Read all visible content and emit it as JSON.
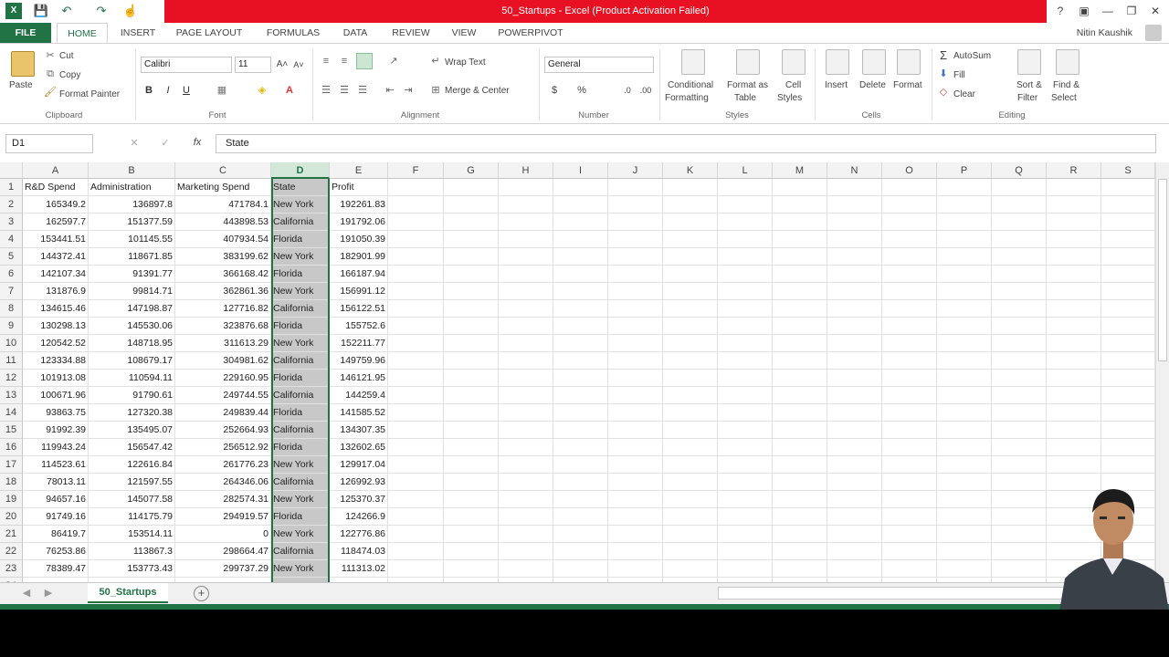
{
  "window": {
    "title": "50_Startups - Excel (Product Activation Failed)",
    "help": "?",
    "ribbon_display": "▣",
    "minimize": "—",
    "restore": "❐",
    "close": "✕"
  },
  "quick_access": {
    "save": "💾",
    "undo": "↶",
    "redo": "↷",
    "touch": "☝"
  },
  "tabs": [
    "FILE",
    "HOME",
    "INSERT",
    "PAGE LAYOUT",
    "FORMULAS",
    "DATA",
    "REVIEW",
    "VIEW",
    "POWERPIVOT"
  ],
  "user": "Nitin Kaushik",
  "ribbon": {
    "clipboard": {
      "paste": "Paste",
      "cut": "Cut",
      "copy": "Copy",
      "format_painter": "Format Painter",
      "label": "Clipboard"
    },
    "font": {
      "name": "Calibri",
      "size": "11",
      "bold": "B",
      "italic": "I",
      "underline": "U",
      "label": "Font"
    },
    "alignment": {
      "wrap": "Wrap Text",
      "merge": "Merge & Center",
      "label": "Alignment"
    },
    "number": {
      "format": "General",
      "currency": "$",
      "percent": "%",
      "label": "Number"
    },
    "styles": {
      "conditional_1": "Conditional",
      "conditional_2": "Formatting",
      "table_1": "Format as",
      "table_2": "Table",
      "cell_1": "Cell",
      "cell_2": "Styles",
      "label": "Styles"
    },
    "cells": {
      "insert": "Insert",
      "delete": "Delete",
      "format": "Format",
      "label": "Cells"
    },
    "editing": {
      "autosum": "AutoSum",
      "fill": "Fill",
      "clear": "Clear",
      "sort_1": "Sort &",
      "sort_2": "Filter",
      "find_1": "Find &",
      "find_2": "Select",
      "label": "Editing"
    }
  },
  "formula_bar": {
    "name_box": "D1",
    "fx": "fx",
    "content": "State"
  },
  "columns": [
    "A",
    "B",
    "C",
    "D",
    "E",
    "F",
    "G",
    "H",
    "I",
    "J",
    "K",
    "L",
    "M",
    "N",
    "O",
    "P",
    "Q",
    "R",
    "S"
  ],
  "header_row": [
    "R&D Spend",
    "Administration",
    "Marketing Spend",
    "State",
    "Profit"
  ],
  "rows": [
    [
      "165349.2",
      "136897.8",
      "471784.1",
      "New York",
      "192261.83"
    ],
    [
      "162597.7",
      "151377.59",
      "443898.53",
      "California",
      "191792.06"
    ],
    [
      "153441.51",
      "101145.55",
      "407934.54",
      "Florida",
      "191050.39"
    ],
    [
      "144372.41",
      "118671.85",
      "383199.62",
      "New York",
      "182901.99"
    ],
    [
      "142107.34",
      "91391.77",
      "366168.42",
      "Florida",
      "166187.94"
    ],
    [
      "131876.9",
      "99814.71",
      "362861.36",
      "New York",
      "156991.12"
    ],
    [
      "134615.46",
      "147198.87",
      "127716.82",
      "California",
      "156122.51"
    ],
    [
      "130298.13",
      "145530.06",
      "323876.68",
      "Florida",
      "155752.6"
    ],
    [
      "120542.52",
      "148718.95",
      "311613.29",
      "New York",
      "152211.77"
    ],
    [
      "123334.88",
      "108679.17",
      "304981.62",
      "California",
      "149759.96"
    ],
    [
      "101913.08",
      "110594.11",
      "229160.95",
      "Florida",
      "146121.95"
    ],
    [
      "100671.96",
      "91790.61",
      "249744.55",
      "California",
      "144259.4"
    ],
    [
      "93863.75",
      "127320.38",
      "249839.44",
      "Florida",
      "141585.52"
    ],
    [
      "91992.39",
      "135495.07",
      "252664.93",
      "California",
      "134307.35"
    ],
    [
      "119943.24",
      "156547.42",
      "256512.92",
      "Florida",
      "132602.65"
    ],
    [
      "114523.61",
      "122616.84",
      "261776.23",
      "New York",
      "129917.04"
    ],
    [
      "78013.11",
      "121597.55",
      "264346.06",
      "California",
      "126992.93"
    ],
    [
      "94657.16",
      "145077.58",
      "282574.31",
      "New York",
      "125370.37"
    ],
    [
      "91749.16",
      "114175.79",
      "294919.57",
      "Florida",
      "124266.9"
    ],
    [
      "86419.7",
      "153514.11",
      "0",
      "New York",
      "122776.86"
    ],
    [
      "76253.86",
      "113867.3",
      "298664.47",
      "California",
      "118474.03"
    ],
    [
      "78389.47",
      "153773.43",
      "299737.29",
      "New York",
      "111313.02"
    ]
  ],
  "sheet": {
    "tab": "50_Startups",
    "add": "+"
  }
}
